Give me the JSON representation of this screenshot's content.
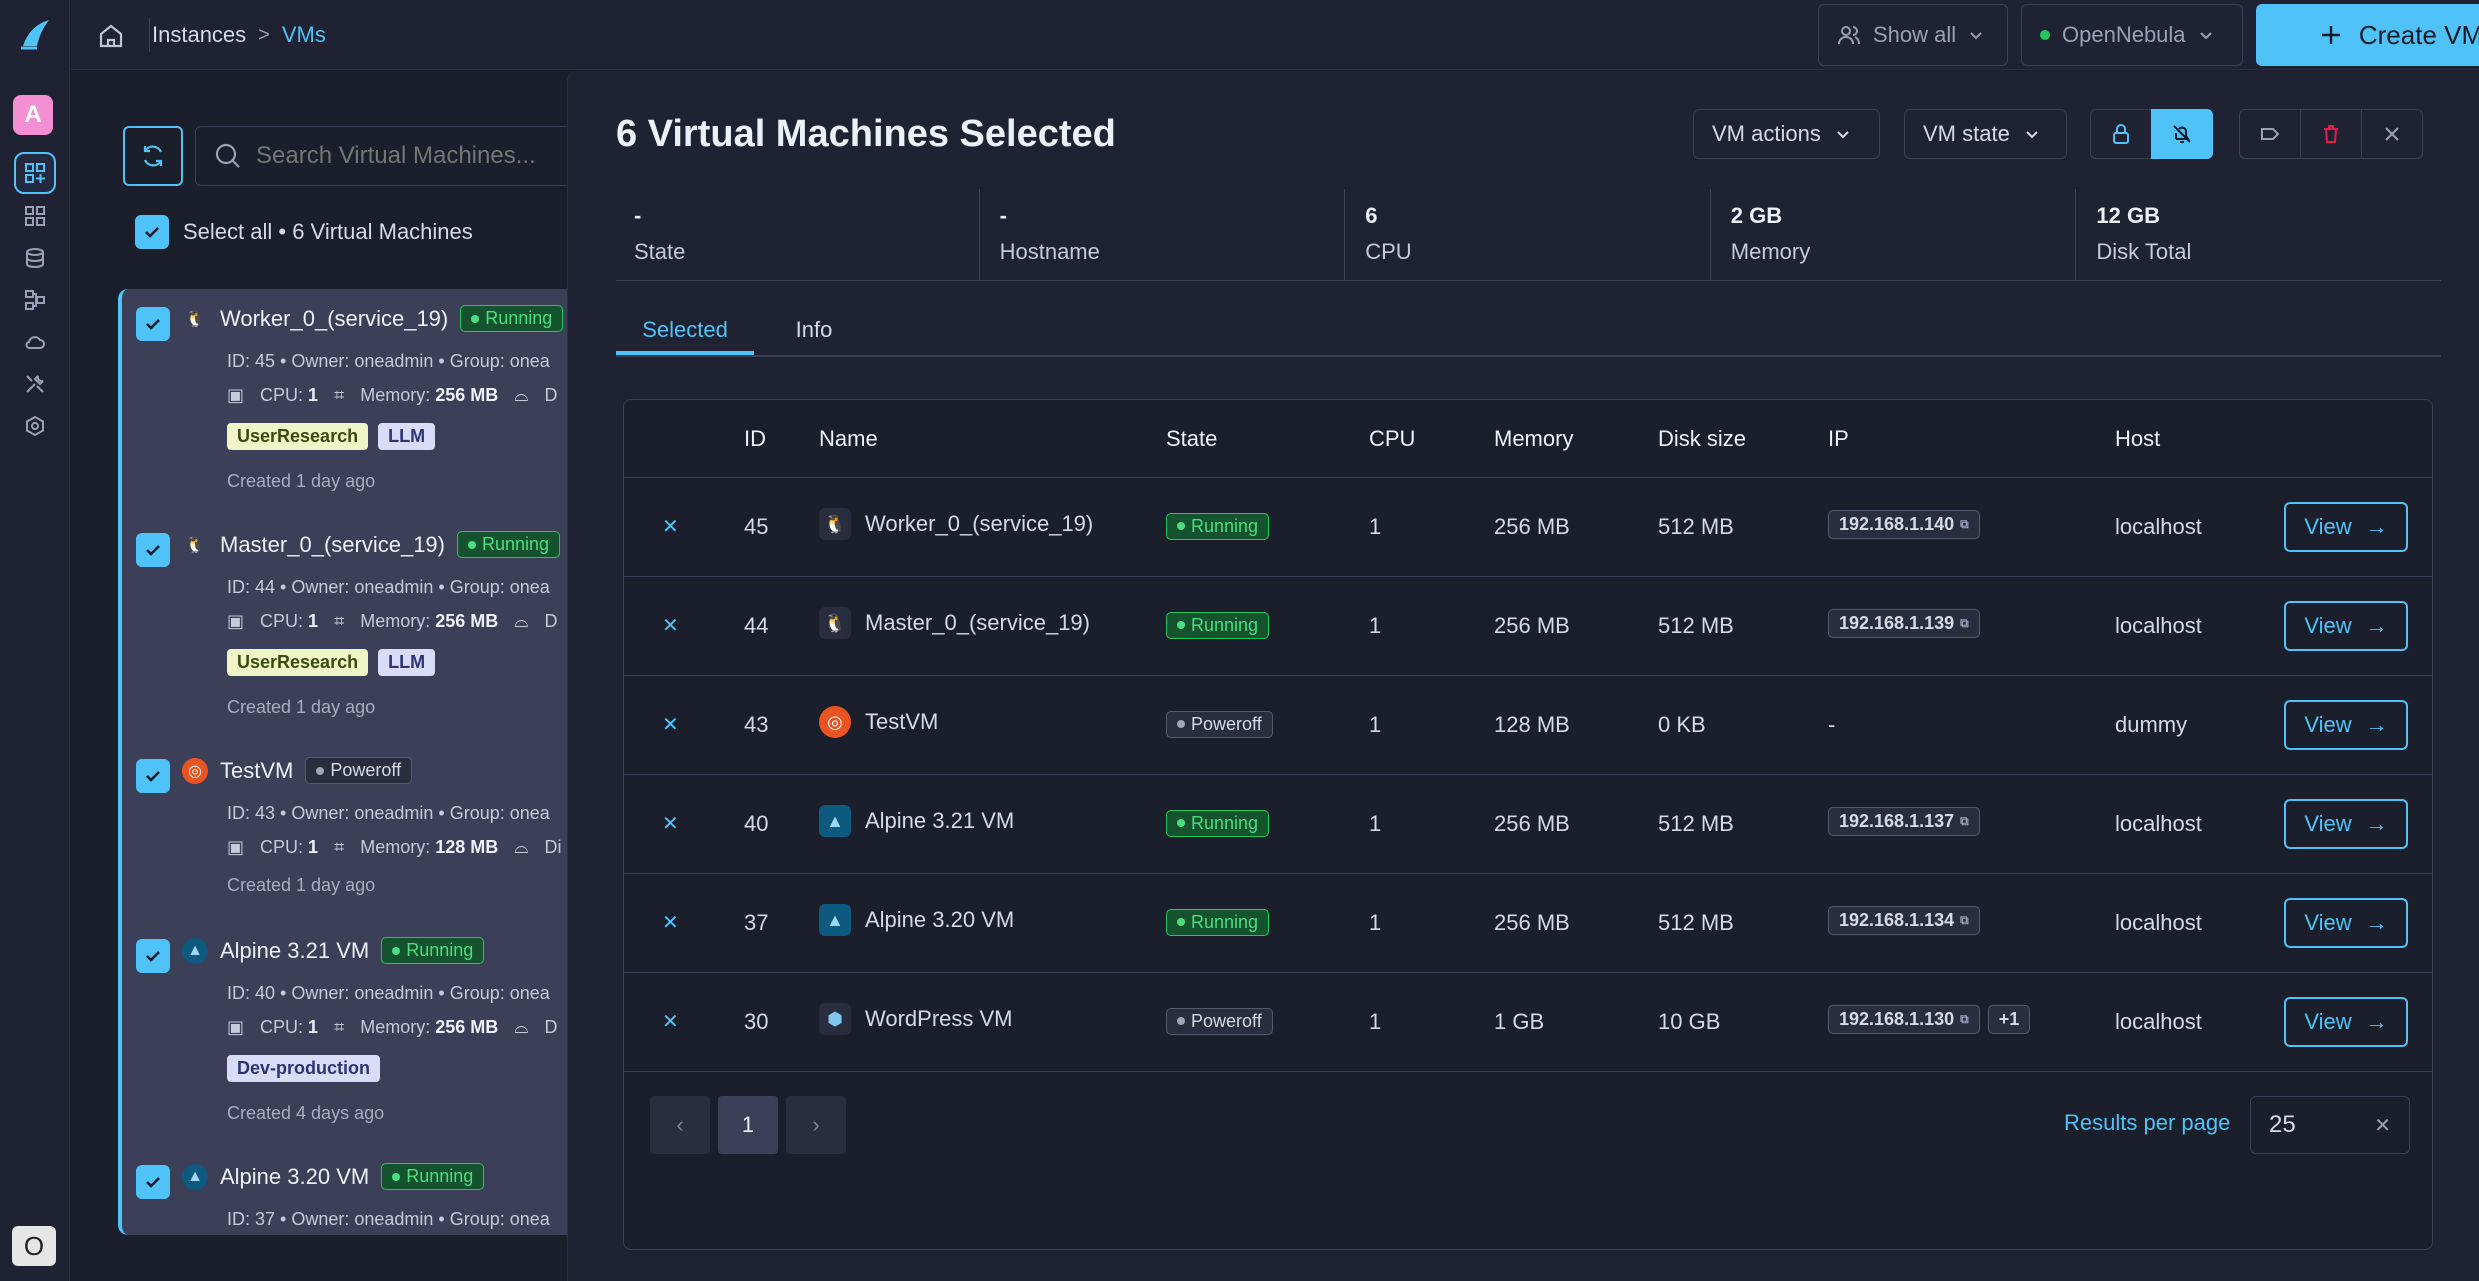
{
  "rail": {
    "avatar_letter": "A",
    "bottom_badge": "O",
    "items": [
      "instances-icon",
      "templates-icon",
      "storage-icon",
      "network-icon",
      "infrastructure-icon",
      "system-icon",
      "settings-icon"
    ]
  },
  "topbar": {
    "breadcrumb_root": "Instances",
    "breadcrumb_sep": ">",
    "breadcrumb_current": "VMs",
    "show_all": "Show all",
    "zone": "OpenNebula",
    "create_vm": "Create VM",
    "zone_status_color": "#22c55e",
    "accent_color": "#4fc3f7"
  },
  "list": {
    "search_placeholder": "Search Virtual Machines...",
    "select_all": "Select all • 6 Virtual Machines",
    "cards": [
      {
        "name": "Worker_0_(service_19)",
        "state": "Running",
        "meta": "ID: 45 • Owner: oneadmin • Group: onea",
        "cpu_label": "CPU:",
        "cpu": "1",
        "mem_label": "Memory:",
        "mem": "256 MB",
        "disk": "D",
        "labels": [
          "UserResearch",
          "LLM"
        ],
        "created": "Created 1 day ago",
        "os": "linux"
      },
      {
        "name": "Master_0_(service_19)",
        "state": "Running",
        "meta": "ID: 44 • Owner: oneadmin • Group: onea",
        "cpu_label": "CPU:",
        "cpu": "1",
        "mem_label": "Memory:",
        "mem": "256 MB",
        "disk": "D",
        "labels": [
          "UserResearch",
          "LLM"
        ],
        "created": "Created 1 day ago",
        "os": "linux"
      },
      {
        "name": "TestVM",
        "state": "Poweroff",
        "meta": "ID: 43 • Owner: oneadmin • Group: onea",
        "cpu_label": "CPU:",
        "cpu": "1",
        "mem_label": "Memory:",
        "mem": "128 MB",
        "disk": "Di",
        "labels": [],
        "created": "Created 1 day ago",
        "os": "ubuntu"
      },
      {
        "name": "Alpine 3.21 VM",
        "state": "Running",
        "meta": "ID: 40 • Owner: oneadmin • Group: onea",
        "cpu_label": "CPU:",
        "cpu": "1",
        "mem_label": "Memory:",
        "mem": "256 MB",
        "disk": "D",
        "labels": [
          "Dev-production"
        ],
        "created": "Created 4 days ago",
        "os": "alpine"
      },
      {
        "name": "Alpine 3.20 VM",
        "state": "Running",
        "meta": "ID: 37 • Owner: oneadmin • Group: onea",
        "os": "alpine"
      }
    ]
  },
  "panel": {
    "title": "6 Virtual Machines Selected",
    "vm_actions": "VM actions",
    "vm_state": "VM state",
    "summary": [
      {
        "value": "-",
        "label": "State"
      },
      {
        "value": "-",
        "label": "Hostname"
      },
      {
        "value": "6",
        "label": "CPU"
      },
      {
        "value": "2 GB",
        "label": "Memory"
      },
      {
        "value": "12 GB",
        "label": "Disk Total"
      }
    ],
    "tabs": [
      "Selected",
      "Info"
    ],
    "columns": [
      "ID",
      "Name",
      "State",
      "CPU",
      "Memory",
      "Disk size",
      "IP",
      "Host"
    ],
    "rows": [
      {
        "id": "45",
        "name": "Worker_0_(service_19)",
        "state": "Running",
        "cpu": "1",
        "memory": "256 MB",
        "disk": "512 MB",
        "ip": "192.168.1.140",
        "ip_extra": "",
        "host": "localhost",
        "os": "linux"
      },
      {
        "id": "44",
        "name": "Master_0_(service_19)",
        "state": "Running",
        "cpu": "1",
        "memory": "256 MB",
        "disk": "512 MB",
        "ip": "192.168.1.139",
        "ip_extra": "",
        "host": "localhost",
        "os": "linux"
      },
      {
        "id": "43",
        "name": "TestVM",
        "state": "Poweroff",
        "cpu": "1",
        "memory": "128 MB",
        "disk": "0 KB",
        "ip": "-",
        "ip_extra": "",
        "host": "dummy",
        "os": "ubuntu"
      },
      {
        "id": "40",
        "name": "Alpine 3.21 VM",
        "state": "Running",
        "cpu": "1",
        "memory": "256 MB",
        "disk": "512 MB",
        "ip": "192.168.1.137",
        "ip_extra": "",
        "host": "localhost",
        "os": "alpine"
      },
      {
        "id": "37",
        "name": "Alpine 3.20 VM",
        "state": "Running",
        "cpu": "1",
        "memory": "256 MB",
        "disk": "512 MB",
        "ip": "192.168.1.134",
        "ip_extra": "",
        "host": "localhost",
        "os": "alpine"
      },
      {
        "id": "30",
        "name": "WordPress VM",
        "state": "Poweroff",
        "cpu": "1",
        "memory": "1 GB",
        "disk": "10 GB",
        "ip": "192.168.1.130",
        "ip_extra": "+1",
        "host": "localhost",
        "os": "wordpress"
      }
    ],
    "view_label": "View",
    "page": "1",
    "results_per_page_label": "Results per page",
    "results_per_page": "25"
  }
}
